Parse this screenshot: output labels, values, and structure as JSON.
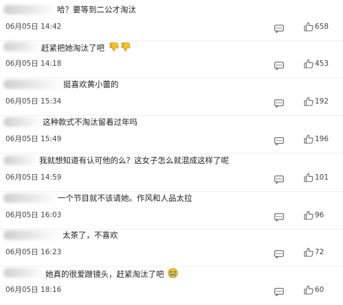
{
  "comments": [
    {
      "text": "哈？要等到二公才淘汰",
      "time": "06月05日 14:42",
      "likes": "658",
      "emoji": ""
    },
    {
      "text": "赶紧把她淘汰了吧",
      "time": "06月05日 14:18",
      "likes": "453",
      "emoji": "thumbs-down-pair"
    },
    {
      "text": "挺喜欢黄小蕾的",
      "time": "06月05日 15:34",
      "likes": "192",
      "emoji": ""
    },
    {
      "text": "这种款式不淘汰留着过年吗",
      "time": "06月05日 15:49",
      "likes": "196",
      "emoji": ""
    },
    {
      "text": "我就想知道有认可他的么？这女子怎么就混成这样了呢",
      "time": "06月05日 14:59",
      "likes": "101",
      "emoji": ""
    },
    {
      "text": "一个节目就不该请她。作风和人品太拉",
      "time": "06月05日 16:03",
      "likes": "96",
      "emoji": ""
    },
    {
      "text": "太茶了，不喜欢",
      "time": "06月05日 16:23",
      "likes": "72",
      "emoji": ""
    },
    {
      "text": "她真的很爱蹭镜头，赶紧淘汰了吧",
      "time": "06月05日 18:16",
      "likes": "60",
      "emoji": "crying-face"
    }
  ],
  "icons": {
    "reply": "comment-bubble-icon",
    "like": "thumbs-up-icon"
  },
  "colors": {
    "text": "#222222",
    "meta": "#444444",
    "icon": "#666666",
    "emoji_yellow": "#f5c22e"
  }
}
